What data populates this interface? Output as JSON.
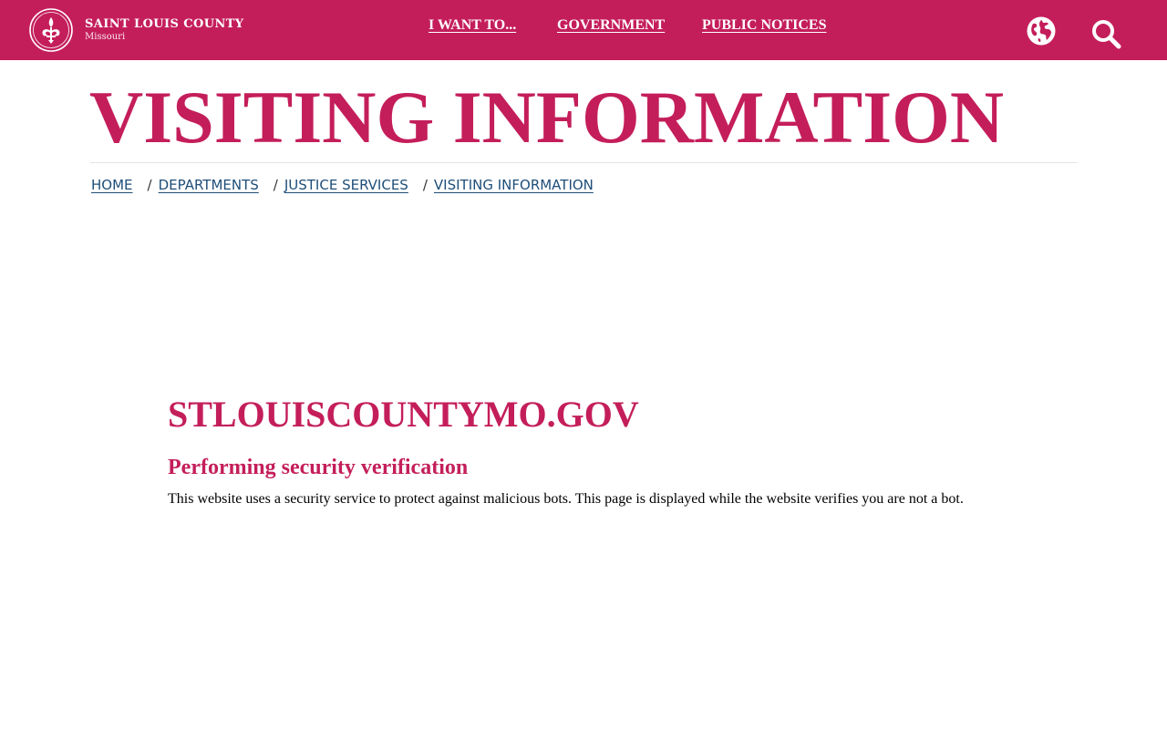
{
  "header": {
    "logo": {
      "name": "SAINT LOUIS COUNTY",
      "state": "Missouri"
    },
    "nav": [
      {
        "label": "I WANT TO..."
      },
      {
        "label": "GOVERNMENT"
      },
      {
        "label": "PUBLIC NOTICES"
      }
    ],
    "icons": {
      "translate": "globe-icon",
      "search": "search-icon"
    },
    "brand_color": "#c41e5a"
  },
  "page": {
    "title": "VISITING INFORMATION"
  },
  "breadcrumb": [
    {
      "label": "HOME"
    },
    {
      "label": "DEPARTMENTS"
    },
    {
      "label": "JUSTICE SERVICES"
    },
    {
      "label": "VISITING INFORMATION"
    }
  ],
  "breadcrumb_separator": "/",
  "verification": {
    "domain": "STLOUISCOUNTYMO.GOV",
    "heading": "Performing security verification",
    "message": "This website uses a security service to protect against malicious bots. This page is displayed while the website verifies you are not a bot."
  },
  "colors": {
    "accent": "#c41e5a",
    "link": "#1e4e79"
  }
}
